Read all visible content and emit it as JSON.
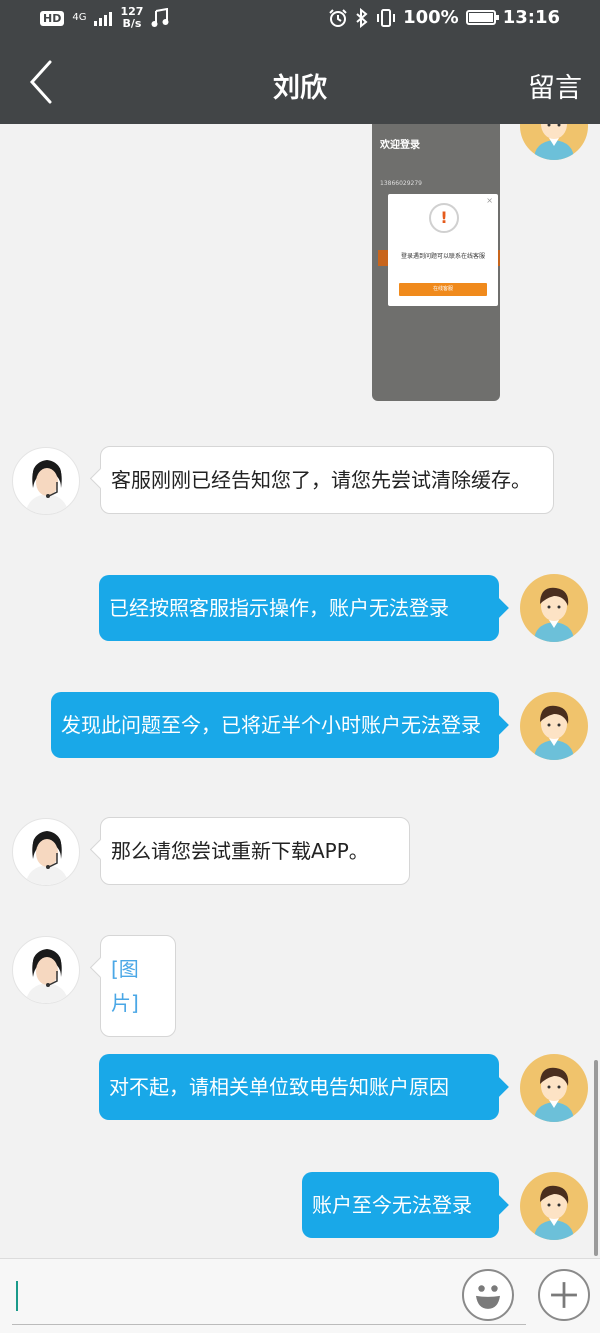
{
  "status_bar": {
    "hd_label": "HD",
    "network_label": "4G",
    "speed_value": "127",
    "speed_unit": "B/s",
    "battery_text": "100%",
    "time": "13:16"
  },
  "header": {
    "title": "刘欣",
    "action_label": "留言"
  },
  "screenshot_image": {
    "welcome_text": "欢迎登录",
    "phone_number": "13866029279",
    "dialog_message": "登录遇到问题可以联系在线客服",
    "dialog_button": "在线客服"
  },
  "messages": [
    {
      "sender": "agent",
      "text": "客服刚刚已经告知您了，请您先尝试清除缓存。"
    },
    {
      "sender": "user",
      "text": "已经按照客服指示操作，账户无法登录"
    },
    {
      "sender": "user",
      "text": "发现此问题至今，已将近半个小时账户无法登录"
    },
    {
      "sender": "agent",
      "text": "那么请您尝试重新下载APP。"
    },
    {
      "sender": "agent",
      "text": "[图片]"
    },
    {
      "sender": "user",
      "text": "对不起，请相关单位致电告知账户原因"
    },
    {
      "sender": "user",
      "text": "账户至今无法登录"
    }
  ],
  "input": {
    "value": "",
    "placeholder": ""
  },
  "colors": {
    "header_bg": "#424547",
    "user_bubble": "#19a8e8",
    "agent_bubble": "#ffffff",
    "chat_bg": "#f2f2f2",
    "user_avatar_bg": "#f0c36c"
  }
}
